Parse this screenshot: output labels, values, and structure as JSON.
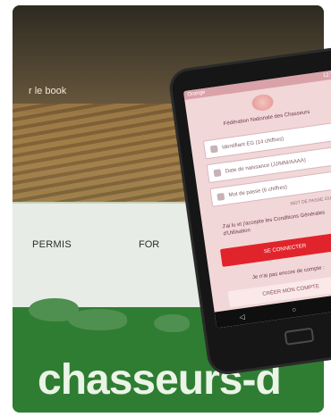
{
  "poster": {
    "book_text": "r le book",
    "permis_text": "PERMIS",
    "for_text": "FOR",
    "brand_text": "chasseurs-d"
  },
  "phone": {
    "status_left": "Orange",
    "status_right": "12:29",
    "app_title": "Fédération Nationale des Chasseurs",
    "fields": [
      {
        "placeholder": "Identifiant EG (14 chiffres)",
        "icon": "user-icon"
      },
      {
        "placeholder": "Date de naissance (JJ/MM/AAAA)",
        "icon": "calendar-icon"
      },
      {
        "placeholder": "Mot de passe (6 chiffres)",
        "icon": "lock-icon"
      }
    ],
    "forgot_password": "MOT DE PASSE OUBLIÉ ?",
    "terms_text": "J'ai lu et j'accepte les Conditions Générales d'Utilisation",
    "login_button": "SE CONNECTER",
    "no_account_text": "Je n'ai pas encore de compte :",
    "create_button": "CRÉER MON COMPTE",
    "nav": [
      {
        "icon": "back-icon",
        "label": "◁"
      },
      {
        "icon": "home-icon",
        "label": "○"
      },
      {
        "icon": "recent-apps-icon",
        "label": "□"
      }
    ]
  },
  "colors": {
    "screen_bg": "#f2d7d8",
    "accent_red": "#e1242c",
    "poster_green": "#2f7d32"
  }
}
